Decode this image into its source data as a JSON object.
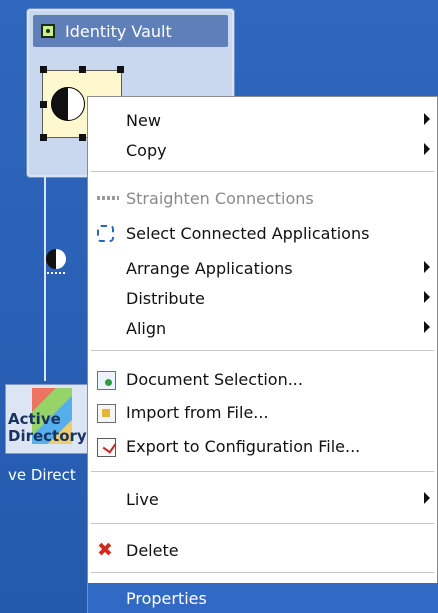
{
  "vault": {
    "title": "Identity Vault"
  },
  "active_directory": {
    "box_label_line1": "Active",
    "box_label_line2": "Directory",
    "caption": "ve Direct"
  },
  "menu": {
    "items": [
      {
        "label": "New",
        "submenu": true
      },
      {
        "label": "Copy",
        "submenu": true
      },
      {
        "label": "Straighten Connections",
        "disabled": true,
        "icon": "straighten-icon"
      },
      {
        "label": "Select Connected Applications",
        "icon": "select-icon"
      },
      {
        "label": "Arrange Applications",
        "submenu": true
      },
      {
        "label": "Distribute",
        "submenu": true
      },
      {
        "label": "Align",
        "submenu": true
      },
      {
        "label": "Document Selection...",
        "icon": "document-selection-icon"
      },
      {
        "label": "Import from File...",
        "icon": "import-file-icon"
      },
      {
        "label": "Export to Configuration File...",
        "icon": "export-config-icon"
      },
      {
        "label": "Live",
        "submenu": true
      },
      {
        "label": "Delete",
        "icon": "delete-icon"
      },
      {
        "label": "Properties",
        "selected": true
      }
    ]
  }
}
